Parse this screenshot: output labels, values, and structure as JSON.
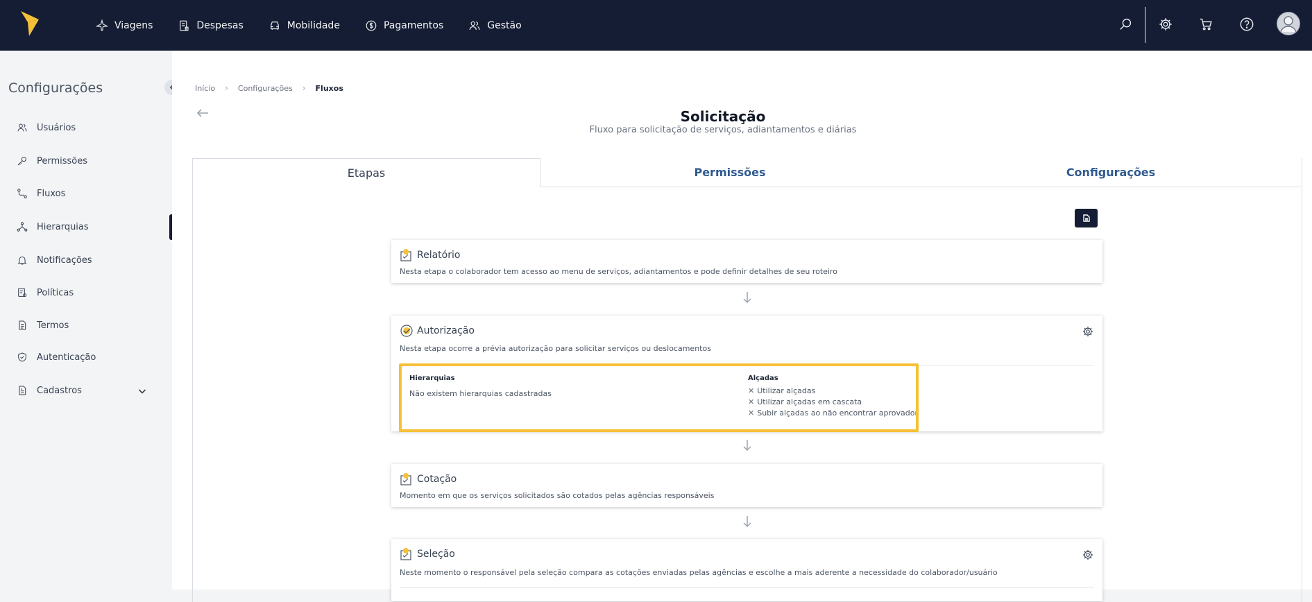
{
  "nav": {
    "items": [
      {
        "label": "Viagens",
        "icon": "plane-icon"
      },
      {
        "label": "Despesas",
        "icon": "receipt-icon"
      },
      {
        "label": "Mobilidade",
        "icon": "car-icon"
      },
      {
        "label": "Pagamentos",
        "icon": "dollar-icon"
      },
      {
        "label": "Gestão",
        "icon": "users-icon"
      }
    ],
    "right_icons": [
      "search-icon",
      "gear-icon",
      "cart-icon",
      "help-icon",
      "avatar"
    ]
  },
  "sidebar": {
    "title": "Configurações",
    "items": [
      {
        "label": "Usuários",
        "icon": "users-icon"
      },
      {
        "label": "Permissões",
        "icon": "key-icon"
      },
      {
        "label": "Fluxos",
        "icon": "flow-icon"
      },
      {
        "label": "Hierarquias",
        "icon": "hierarchy-icon"
      },
      {
        "label": "Notificações",
        "icon": "bell-icon"
      },
      {
        "label": "Políticas",
        "icon": "policy-icon"
      },
      {
        "label": "Termos",
        "icon": "document-icon"
      },
      {
        "label": "Autenticação",
        "icon": "shield-icon"
      },
      {
        "label": "Cadastros",
        "icon": "register-icon"
      }
    ]
  },
  "breadcrumb": {
    "items": [
      "Início",
      "Configurações",
      "Fluxos"
    ]
  },
  "page": {
    "title": "Solicitação",
    "subtitle": "Fluxo para solicitação de serviços, adiantamentos e diárias"
  },
  "tabs": [
    {
      "label": "Etapas",
      "active": true
    },
    {
      "label": "Permissões",
      "active": false
    },
    {
      "label": "Configurações",
      "active": false
    }
  ],
  "steps": {
    "relatorio": {
      "title": "Relatório",
      "desc": "Nesta etapa o colaborador tem acesso ao menu de serviços, adiantamentos e pode definir detalhes de seu roteiro"
    },
    "autorizacao": {
      "title": "Autorização",
      "desc": "Nesta etapa ocorre a prévia autorização para solicitar serviços ou deslocamentos",
      "hierarquias_label": "Hierarquias",
      "hierarquias_value": "Não existem hierarquias cadastradas",
      "alcadas_label": "Alçadas",
      "alcadas_options": [
        "Utilizar alçadas",
        "Utilizar alçadas em cascata",
        "Subir alçadas ao não encontrar aprovador"
      ]
    },
    "cotacao": {
      "title": "Cotação",
      "desc": "Momento em que os serviços solicitados são cotados pelas agências responsáveis"
    },
    "selecao": {
      "title": "Seleção",
      "desc": "Neste momento o responsável pela seleção compara as cotações enviadas pelas agências e escolhe a mais aderente a necessidade do colaborador/usuário"
    }
  },
  "colors": {
    "topbar": "#141d33",
    "accent": "#f6c138",
    "tab_link": "#2f5a8f"
  }
}
